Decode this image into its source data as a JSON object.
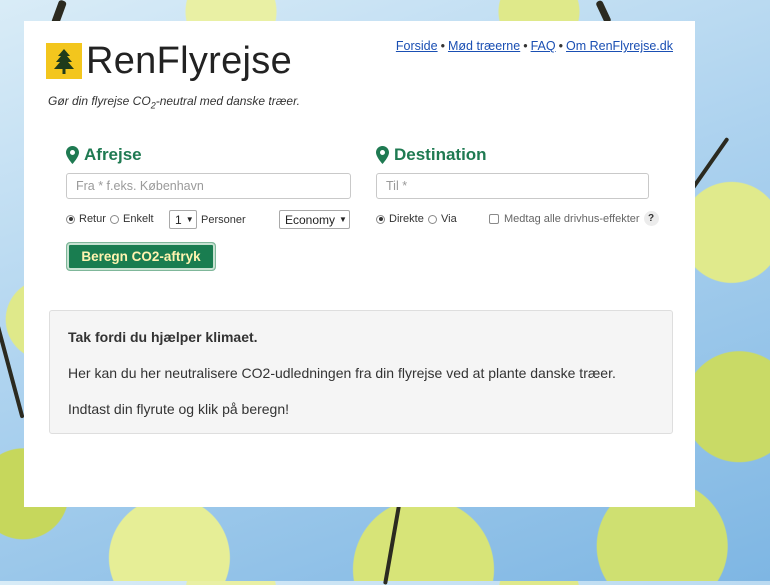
{
  "brand": {
    "name": "RenFlyrejse",
    "logo_icon": "tree-icon",
    "accent": "#1f7a52",
    "logo_bg": "#f3c61d"
  },
  "tagline": {
    "before": "Gør din flyrejse CO",
    "sub": "2",
    "after": "-neutral med danske træer."
  },
  "nav": {
    "items": [
      "Forside",
      "Mød træerne",
      "FAQ",
      "Om RenFlyrejse.dk"
    ],
    "separator": "•"
  },
  "departure": {
    "title": "Afrejse",
    "placeholder": "Fra * f.eks. København",
    "value": ""
  },
  "destination": {
    "title": "Destination",
    "placeholder": "Til *",
    "value": ""
  },
  "trip_type": {
    "options": [
      "Retur",
      "Enkelt"
    ],
    "selected": "Retur"
  },
  "persons": {
    "value": "1",
    "label": "Personer"
  },
  "cabin_class": {
    "value": "Economy"
  },
  "route": {
    "options": [
      "Direkte",
      "Via"
    ],
    "selected": "Direkte"
  },
  "greenhouse": {
    "label": "Medtag alle drivhus-effekter",
    "checked": false,
    "help": "?"
  },
  "calculate_button": {
    "label": "Beregn CO2-aftryk"
  },
  "info": {
    "heading": "Tak fordi du hjælper klimaet.",
    "line1": "Her kan du her neutralisere CO2-udledningen fra din flyrejse ved at plante danske træer.",
    "line2": "Indtast din flyrute og klik på beregn!"
  }
}
